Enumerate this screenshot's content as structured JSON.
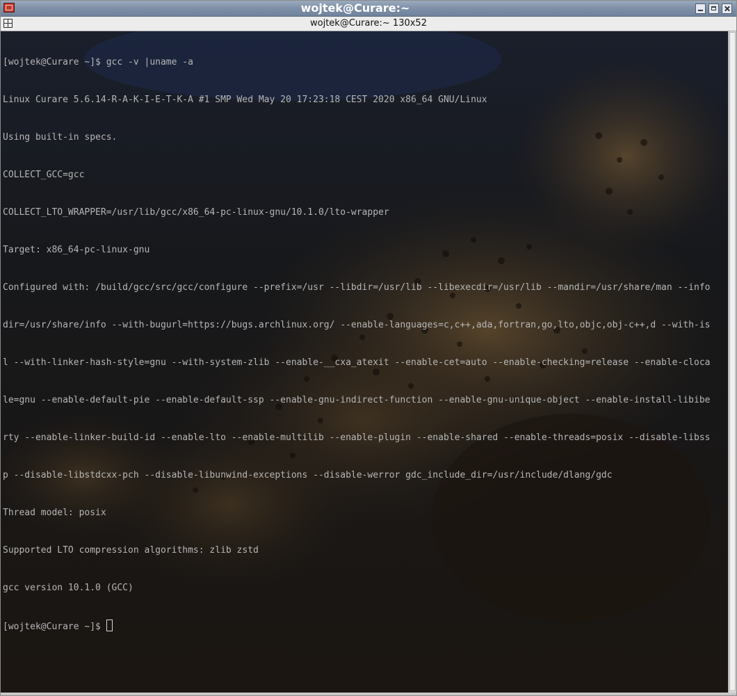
{
  "window": {
    "title": "wojtek@Curare:~",
    "colors": {
      "titlebar": "#7e90a8",
      "terminal_text": "#b6b6b6",
      "terminal_bg": "#141312"
    }
  },
  "tab": {
    "title": "wojtek@Curare:~ 130x52"
  },
  "terminal": {
    "lines": [
      "[wojtek@Curare ~]$ gcc -v |uname -a",
      "Linux Curare 5.6.14-R-A-K-I-E-T-K-A #1 SMP Wed May 20 17:23:18 CEST 2020 x86_64 GNU/Linux",
      "Using built-in specs.",
      "COLLECT_GCC=gcc",
      "COLLECT_LTO_WRAPPER=/usr/lib/gcc/x86_64-pc-linux-gnu/10.1.0/lto-wrapper",
      "Target: x86_64-pc-linux-gnu",
      "Configured with: /build/gcc/src/gcc/configure --prefix=/usr --libdir=/usr/lib --libexecdir=/usr/lib --mandir=/usr/share/man --info",
      "dir=/usr/share/info --with-bugurl=https://bugs.archlinux.org/ --enable-languages=c,c++,ada,fortran,go,lto,objc,obj-c++,d --with-is",
      "l --with-linker-hash-style=gnu --with-system-zlib --enable-__cxa_atexit --enable-cet=auto --enable-checking=release --enable-cloca",
      "le=gnu --enable-default-pie --enable-default-ssp --enable-gnu-indirect-function --enable-gnu-unique-object --enable-install-libibe",
      "rty --enable-linker-build-id --enable-lto --enable-multilib --enable-plugin --enable-shared --enable-threads=posix --disable-libss",
      "p --disable-libstdcxx-pch --disable-libunwind-exceptions --disable-werror gdc_include_dir=/usr/include/dlang/gdc",
      "Thread model: posix",
      "Supported LTO compression algorithms: zlib zstd",
      "gcc version 10.1.0 (GCC)"
    ],
    "prompt": "[wojtek@Curare ~]$ "
  },
  "icons": {
    "window_menu": "window-menu-icon",
    "minimize": "minimize-icon",
    "maximize": "maximize-icon",
    "close": "close-icon",
    "tab_menu": "tab-menu-icon"
  }
}
